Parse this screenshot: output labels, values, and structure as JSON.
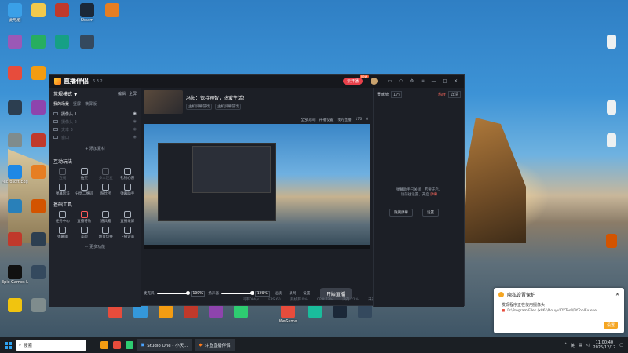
{
  "desktop": {
    "icons": [
      {
        "label": "此电脑",
        "color": "#3aa0e8"
      },
      {
        "label": "",
        "color": "#f2c94c"
      },
      {
        "label": "",
        "color": "#c0392b"
      },
      {
        "label": "Steam",
        "color": "#1b2838"
      },
      {
        "label": "",
        "color": "#e67e22"
      },
      {
        "label": "",
        "color": "#9b59b6"
      },
      {
        "label": "",
        "color": "#27ae60"
      },
      {
        "label": "Epic Games Launcher",
        "color": "#111111"
      },
      {
        "label": "Microsoft Edge",
        "color": "#1e88e5"
      },
      {
        "label": "WeGame",
        "color": "#e74c3c"
      }
    ],
    "right_icons": [
      {
        "label": "",
        "color": "#ecf0f1"
      },
      {
        "label": "",
        "color": "#ecf0f1"
      },
      {
        "label": "",
        "color": "#ecf0f1"
      },
      {
        "label": "",
        "color": "#d35400"
      }
    ]
  },
  "app": {
    "name": "直播伴侣",
    "version": "6.3.2",
    "live_btn": "去开播",
    "live_badge": "new",
    "left": {
      "mode": "常规模式 ▼",
      "actions": [
        "编辑",
        "全屏"
      ],
      "tabs": [
        "我的场景",
        "竖屏",
        "横屏版"
      ],
      "cameras": [
        {
          "name": "摄像头 1",
          "dim": false
        },
        {
          "name": "摄像头 2",
          "dim": true
        },
        {
          "name": "文本 3",
          "dim": true
        },
        {
          "name": "窗口",
          "dim": true
        }
      ],
      "add_source": "+ 添加素材",
      "interactive_title": "互动玩法",
      "interactive_tools": [
        {
          "label": "连线",
          "dim": true
        },
        {
          "label": "抽奖",
          "dim": false
        },
        {
          "label": "多人连麦",
          "dim": true
        },
        {
          "label": "礼物心愿",
          "dim": false
        },
        {
          "label": "弹幕玩法",
          "dim": false
        },
        {
          "label": "分享二维码",
          "dim": false
        },
        {
          "label": "粉丝团",
          "dim": false
        },
        {
          "label": "弹幕助手",
          "dim": false
        }
      ],
      "basic_title": "基础工具",
      "basic_tools": [
        {
          "label": "任务中心",
          "dim": false
        },
        {
          "label": "直播特效",
          "dim": false
        },
        {
          "label": "道具箱",
          "dim": false
        },
        {
          "label": "直播录屏",
          "dim": false
        },
        {
          "label": "弹幕库",
          "dim": false
        },
        {
          "label": "美颜",
          "dim": false
        },
        {
          "label": "场景切换",
          "dim": false
        },
        {
          "label": "下播设置",
          "dim": false
        }
      ],
      "more": "··· 更多功能"
    },
    "center": {
      "title": "冯阳：保持理智，热爱生活！",
      "chips": [
        "主机屏幕游戏",
        "主机屏幕游戏"
      ],
      "stats": [
        "全部房间",
        "开播设置",
        "我的直播",
        "176",
        "0"
      ],
      "mixer": {
        "mic_label": "麦克风",
        "mic_pct": "100%",
        "spk_label": "扬声器",
        "spk_pct": "100%",
        "small": [
          "画质",
          "录制",
          "设置"
        ],
        "start": "开始直播"
      },
      "status": [
        "码率0kb/s",
        "FPS:60",
        "丢帧率:0%",
        "CPU:13%",
        "内存:21%",
        "未开播"
      ]
    },
    "right": {
      "head": [
        "贡献榜",
        "1万",
        "热度",
        "详情"
      ],
      "message": "弹幕助手已关闭，若要开启，",
      "message2": "请前往设置，开启",
      "link": "弹幕",
      "btns": [
        "隐藏弹幕",
        "设置"
      ]
    }
  },
  "notification": {
    "title": "隐私设置保护",
    "line": "发现程序正在使用摄像头",
    "path": "D:\\Program Files (x86)\\Douyu\\DYTool\\DYToolEx.exe",
    "btn": "设置"
  },
  "taskbar": {
    "search": "搜索",
    "tasks": [
      "Studio One - 小天...",
      "斗鱼直播伴侣"
    ],
    "ime": "英",
    "time": "11:00:40",
    "date": "2025/12/12"
  }
}
